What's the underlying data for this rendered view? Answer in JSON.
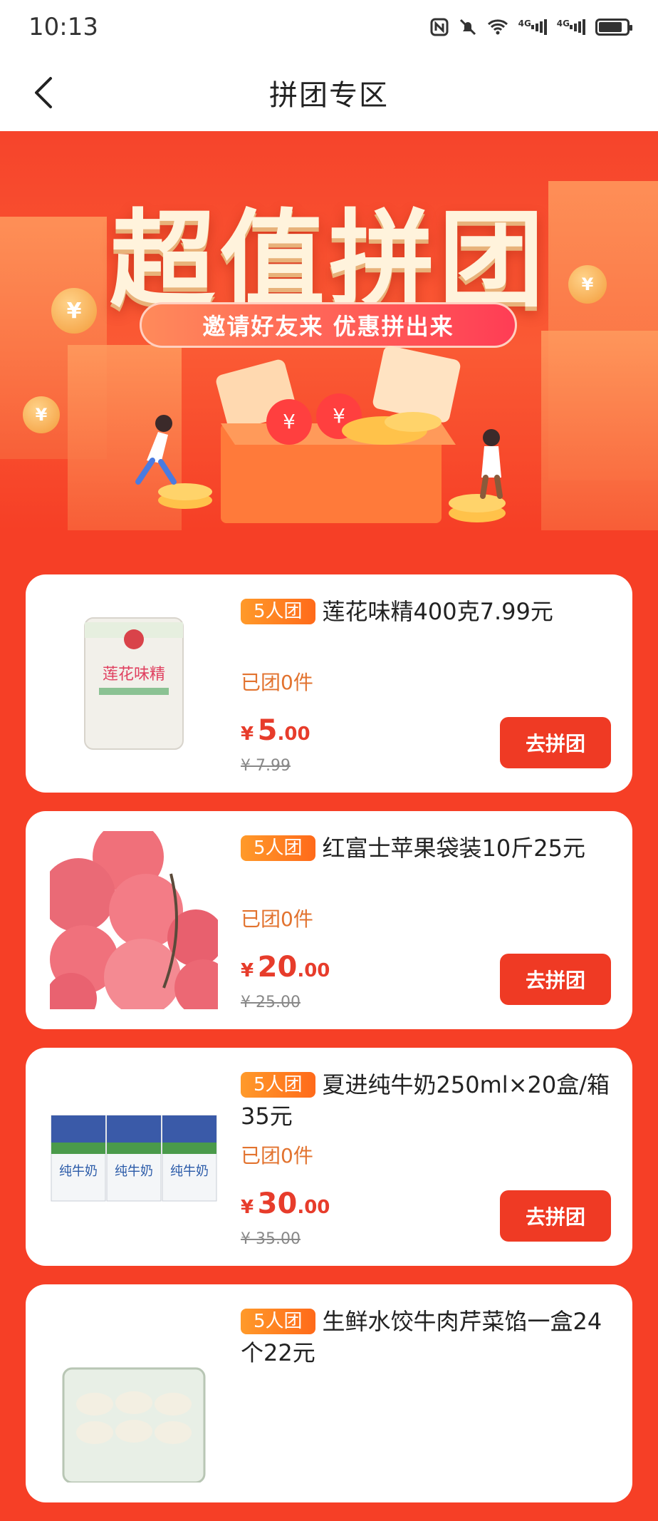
{
  "status_bar": {
    "time": "10:13",
    "net1": "4G",
    "net2": "4G"
  },
  "nav": {
    "title": "拼团专区"
  },
  "banner": {
    "title": "超值拼团",
    "slogan": "邀请好友来 优惠拼出来",
    "coin_symbol": "¥"
  },
  "products": [
    {
      "badge": "5人团",
      "name": "莲花味精400克7.99元",
      "joined": "已团0件",
      "price_symbol": "¥",
      "price_int": "5",
      "price_dec": ".00",
      "original": "¥ 7.99",
      "button": "去拼团",
      "image_label": "莲花味精"
    },
    {
      "badge": "5人团",
      "name": "红富士苹果袋装10斤25元",
      "joined": "已团0件",
      "price_symbol": "¥",
      "price_int": "20",
      "price_dec": ".00",
      "original": "¥ 25.00",
      "button": "去拼团",
      "image_label": ""
    },
    {
      "badge": "5人团",
      "name": "夏进纯牛奶250ml×20盒/箱35元",
      "joined": "已团0件",
      "price_symbol": "¥",
      "price_int": "30",
      "price_dec": ".00",
      "original": "¥ 35.00",
      "button": "去拼团",
      "image_label": "纯牛奶"
    },
    {
      "badge": "5人团",
      "name": "生鲜水饺牛肉芹菜馅一盒24个22元",
      "joined": "",
      "price_symbol": "",
      "price_int": "",
      "price_dec": "",
      "original": "",
      "button": "",
      "image_label": ""
    }
  ],
  "colors": {
    "page_bg": "#f63f26",
    "button": "#ef3a24",
    "badge": "#ff7a1f",
    "joined_text": "#e2732f"
  }
}
